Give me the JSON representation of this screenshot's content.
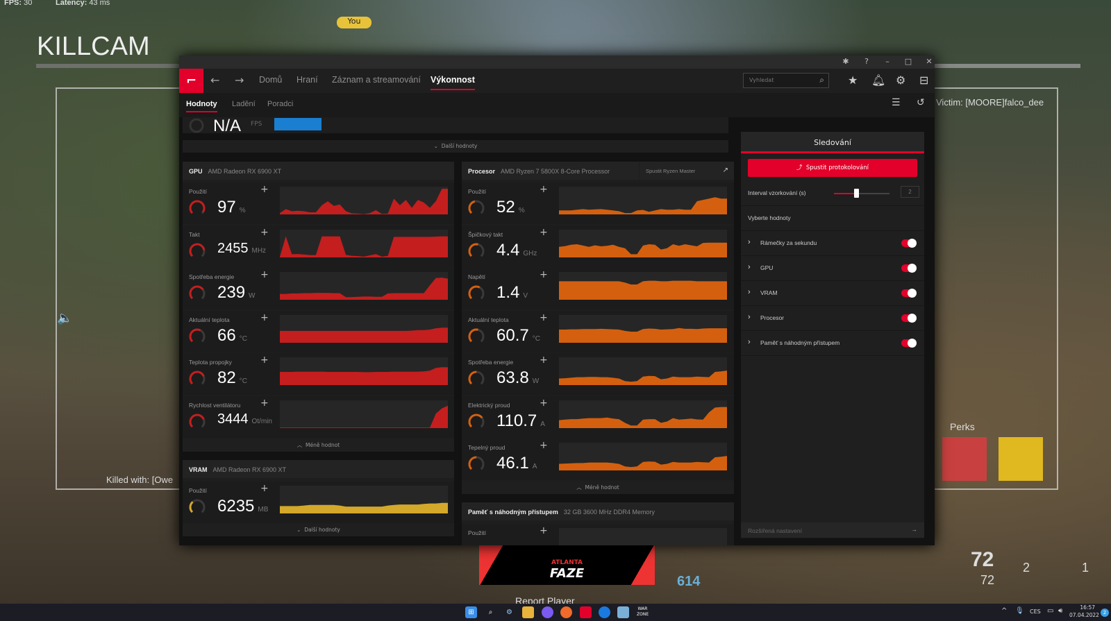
{
  "game_hud": {
    "fps_label": "FPS:",
    "fps": "30",
    "latency_label": "Latency:",
    "latency": "43 ms",
    "killcam": "KILLCAM",
    "you_tag": "You",
    "victim": "Victim: [MOORE]falco_dee",
    "killed_with": "Killed with: [Owe",
    "perks_label": "Perks",
    "ammo": "72",
    "reserve": "72",
    "lethal_count": "2",
    "tactical_count": "1",
    "score": "614",
    "banner_small": "ATLANTA",
    "banner_big": "FAZE",
    "report": "Report Player"
  },
  "window": {
    "colors": {
      "accent": "#e3002a",
      "gpu": "#c41e1e",
      "cpu": "#d4600f",
      "vram": "#d4a82a",
      "fps": "#1a7fd0"
    }
  },
  "nav": {
    "items": [
      "Domů",
      "Hraní",
      "Záznam a streamování",
      "Výkonnost"
    ],
    "active": 3,
    "search_placeholder": "Vyhledat"
  },
  "subnav": {
    "items": [
      "Hodnoty",
      "Ladění",
      "Poradci"
    ],
    "active": 0
  },
  "fps": {
    "value": "N/A",
    "unit": "FPS",
    "more": "Další hodnoty"
  },
  "gpu": {
    "label": "GPU",
    "name": "AMD Radeon RX 6900 XT",
    "less": "Méně hodnot",
    "metrics": [
      {
        "label": "Použití",
        "value": "97",
        "unit": "%",
        "gauge": 0.95,
        "spark": [
          0.05,
          0.2,
          0.12,
          0.14,
          0.12,
          0.08,
          0.08,
          0.35,
          0.5,
          0.32,
          0.38,
          0.12,
          0.04,
          0.03,
          0.01,
          0.05,
          0.16,
          0.02,
          0.03,
          0.6,
          0.35,
          0.55,
          0.25,
          0.55,
          0.45,
          0.25,
          0.5,
          0.97,
          0.97
        ]
      },
      {
        "label": "Takt",
        "value": "2455",
        "unit": "MHz",
        "gauge": 0.8,
        "spark": [
          0.02,
          0.8,
          0.12,
          0.13,
          0.11,
          0.09,
          0.09,
          0.8,
          0.8,
          0.8,
          0.8,
          0.1,
          0.06,
          0.05,
          0.03,
          0.08,
          0.13,
          0.03,
          0.06,
          0.78,
          0.78,
          0.78,
          0.78,
          0.78,
          0.78,
          0.78,
          0.79,
          0.8,
          0.8
        ]
      },
      {
        "label": "Spotřeba energie",
        "value": "239",
        "unit": "W",
        "gauge": 0.7,
        "spark": [
          0.22,
          0.22,
          0.24,
          0.24,
          0.25,
          0.25,
          0.26,
          0.26,
          0.26,
          0.25,
          0.25,
          0.1,
          0.1,
          0.11,
          0.12,
          0.12,
          0.11,
          0.11,
          0.24,
          0.25,
          0.25,
          0.25,
          0.25,
          0.25,
          0.25,
          0.55,
          0.82,
          0.84,
          0.8
        ]
      },
      {
        "label": "Aktuální teplota",
        "value": "66",
        "unit": "°C",
        "gauge": 0.6,
        "spark": [
          0.45,
          0.45,
          0.45,
          0.45,
          0.45,
          0.45,
          0.45,
          0.45,
          0.45,
          0.45,
          0.45,
          0.45,
          0.45,
          0.45,
          0.45,
          0.45,
          0.45,
          0.45,
          0.45,
          0.45,
          0.45,
          0.45,
          0.46,
          0.48,
          0.48,
          0.5,
          0.55,
          0.57,
          0.57
        ]
      },
      {
        "label": "Teplota propojky",
        "value": "82",
        "unit": "°C",
        "gauge": 0.75,
        "spark": [
          0.5,
          0.5,
          0.5,
          0.51,
          0.51,
          0.51,
          0.51,
          0.51,
          0.5,
          0.5,
          0.5,
          0.5,
          0.5,
          0.5,
          0.49,
          0.49,
          0.5,
          0.5,
          0.5,
          0.51,
          0.51,
          0.51,
          0.51,
          0.51,
          0.52,
          0.55,
          0.65,
          0.68,
          0.68
        ]
      },
      {
        "label": "Rychlost ventilátoru",
        "value": "3444",
        "unit": "Ot/min",
        "gauge": 0.75,
        "spark": [
          0.02,
          0.02,
          0.02,
          0.02,
          0.02,
          0.02,
          0.02,
          0.02,
          0.02,
          0.02,
          0.02,
          0.02,
          0.02,
          0.02,
          0.02,
          0.02,
          0.02,
          0.02,
          0.02,
          0.02,
          0.02,
          0.02,
          0.02,
          0.02,
          0.02,
          0.02,
          0.55,
          0.75,
          0.85
        ]
      }
    ]
  },
  "vram": {
    "label": "VRAM",
    "name": "AMD Radeon RX 6900 XT",
    "more": "Další hodnoty",
    "metrics": [
      {
        "label": "Použití",
        "value": "6235",
        "unit": "MB",
        "gauge": 0.35,
        "spark": [
          0.28,
          0.28,
          0.28,
          0.28,
          0.3,
          0.32,
          0.32,
          0.32,
          0.32,
          0.32,
          0.3,
          0.26,
          0.26,
          0.26,
          0.26,
          0.26,
          0.26,
          0.26,
          0.3,
          0.32,
          0.34,
          0.34,
          0.34,
          0.34,
          0.36,
          0.38,
          0.38,
          0.4,
          0.4
        ]
      }
    ]
  },
  "cpu": {
    "label": "Procesor",
    "name": "AMD Ryzen 7 5800X 8-Core Processor",
    "ryzen_master": "Spustit Ryzen Master",
    "less": "Méně hodnot",
    "metrics": [
      {
        "label": "Použití",
        "value": "52",
        "unit": "%",
        "gauge": 0.45,
        "spark": [
          0.15,
          0.15,
          0.15,
          0.18,
          0.2,
          0.18,
          0.19,
          0.2,
          0.18,
          0.15,
          0.12,
          0.05,
          0.05,
          0.15,
          0.17,
          0.1,
          0.15,
          0.2,
          0.18,
          0.18,
          0.2,
          0.18,
          0.18,
          0.5,
          0.55,
          0.6,
          0.65,
          0.6,
          0.6
        ]
      },
      {
        "label": "Špičkový takt",
        "value": "4.4",
        "unit": "GHz",
        "gauge": 0.55,
        "spark": [
          0.4,
          0.43,
          0.48,
          0.5,
          0.45,
          0.4,
          0.46,
          0.42,
          0.44,
          0.48,
          0.4,
          0.35,
          0.12,
          0.12,
          0.45,
          0.5,
          0.48,
          0.3,
          0.35,
          0.5,
          0.44,
          0.5,
          0.46,
          0.42,
          0.55,
          0.56,
          0.56,
          0.56,
          0.56
        ]
      },
      {
        "label": "Napětí",
        "value": "1.4",
        "unit": "V",
        "gauge": 0.6,
        "spark": [
          0.7,
          0.7,
          0.7,
          0.7,
          0.7,
          0.7,
          0.7,
          0.7,
          0.7,
          0.7,
          0.7,
          0.65,
          0.58,
          0.58,
          0.7,
          0.72,
          0.72,
          0.7,
          0.7,
          0.72,
          0.72,
          0.72,
          0.72,
          0.7,
          0.7,
          0.7,
          0.7,
          0.7,
          0.7
        ]
      },
      {
        "label": "Aktuální teplota",
        "value": "60.7",
        "unit": "°C",
        "gauge": 0.55,
        "spark": [
          0.5,
          0.5,
          0.51,
          0.51,
          0.52,
          0.52,
          0.52,
          0.53,
          0.52,
          0.51,
          0.5,
          0.45,
          0.42,
          0.42,
          0.52,
          0.54,
          0.53,
          0.5,
          0.51,
          0.52,
          0.56,
          0.53,
          0.53,
          0.52,
          0.54,
          0.55,
          0.55,
          0.55,
          0.55
        ]
      },
      {
        "label": "Spotřeba energie",
        "value": "63.8",
        "unit": "W",
        "gauge": 0.5,
        "spark": [
          0.25,
          0.26,
          0.28,
          0.3,
          0.3,
          0.31,
          0.31,
          0.3,
          0.3,
          0.28,
          0.25,
          0.15,
          0.13,
          0.15,
          0.32,
          0.35,
          0.34,
          0.22,
          0.25,
          0.32,
          0.3,
          0.3,
          0.3,
          0.32,
          0.31,
          0.3,
          0.5,
          0.52,
          0.55
        ]
      },
      {
        "label": "Elektrický proud",
        "value": "110.7",
        "unit": "A",
        "gauge": 0.7,
        "spark": [
          0.3,
          0.32,
          0.34,
          0.34,
          0.36,
          0.38,
          0.38,
          0.38,
          0.4,
          0.36,
          0.34,
          0.2,
          0.1,
          0.1,
          0.32,
          0.34,
          0.34,
          0.2,
          0.25,
          0.38,
          0.32,
          0.34,
          0.36,
          0.33,
          0.32,
          0.6,
          0.78,
          0.8,
          0.8
        ]
      },
      {
        "label": "Tepelný proud",
        "value": "46.1",
        "unit": "A",
        "gauge": 0.5,
        "spark": [
          0.25,
          0.26,
          0.27,
          0.28,
          0.28,
          0.3,
          0.3,
          0.3,
          0.3,
          0.28,
          0.25,
          0.15,
          0.13,
          0.15,
          0.32,
          0.34,
          0.33,
          0.22,
          0.25,
          0.32,
          0.3,
          0.3,
          0.3,
          0.32,
          0.31,
          0.3,
          0.5,
          0.52,
          0.55
        ]
      }
    ]
  },
  "ram": {
    "label": "Paměť s náhodným přístupem",
    "name": "32 GB 3600 MHz DDR4 Memory",
    "metrics": [
      {
        "label": "Použití"
      }
    ]
  },
  "tracking": {
    "title": "Sledování",
    "start_logging": "Spustit protokolování",
    "interval_label": "Interval vzorkování (s)",
    "interval_value": "2",
    "interval_fraction": 0.4,
    "select_label": "Vyberte hodnoty",
    "items": [
      {
        "label": "Rámečky za sekundu",
        "on": true
      },
      {
        "label": "GPU",
        "on": true
      },
      {
        "label": "VRAM",
        "on": true
      },
      {
        "label": "Procesor",
        "on": true
      },
      {
        "label": "Paměť s náhodným přístupem",
        "on": true
      }
    ],
    "advanced": "Rozšířená nastavení"
  },
  "taskbar": {
    "lang": "CES",
    "time": "16:57",
    "date": "07.04.2022",
    "notifications": "2",
    "war1": "WAR",
    "war2": "ZONE"
  }
}
